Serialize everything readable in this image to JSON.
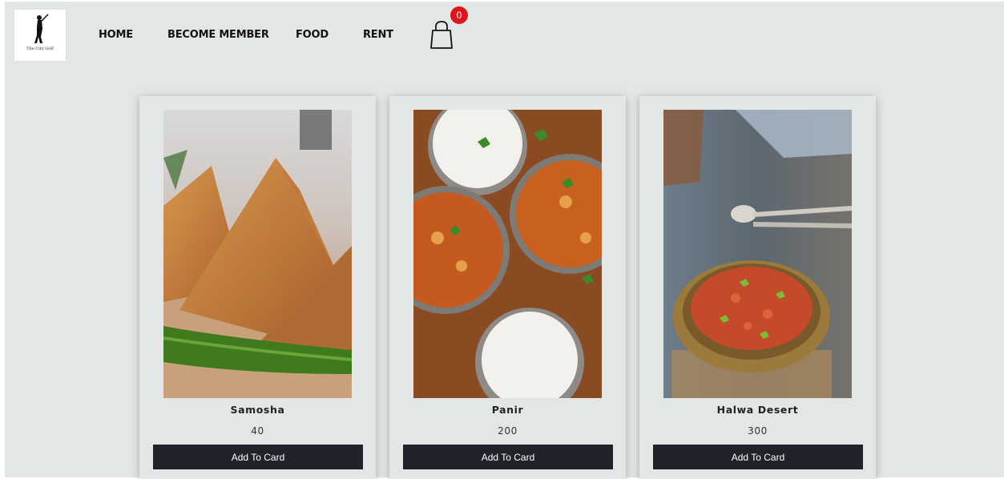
{
  "header": {
    "logo_text": "The City Golf",
    "nav": [
      {
        "label": "HOME"
      },
      {
        "label": "BECOME MEMBER"
      },
      {
        "label": "FOOD"
      },
      {
        "label": "RENT"
      }
    ],
    "cart_icon": "shopping-bag-icon",
    "cart_count": "0"
  },
  "colors": {
    "page_bg": "#e3e6e7",
    "button_bg": "#1f2329",
    "badge_bg": "#e0141b"
  },
  "products": [
    {
      "name": "Samosha",
      "price": "40",
      "button_label": "Add To Card"
    },
    {
      "name": "Panir",
      "price": "200",
      "button_label": "Add To Card"
    },
    {
      "name": "Halwa Desert",
      "price": "300",
      "button_label": "Add To Card"
    }
  ]
}
